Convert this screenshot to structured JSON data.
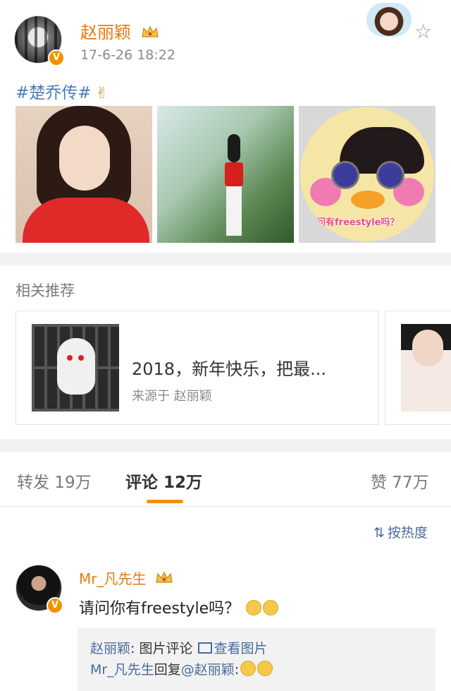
{
  "post": {
    "author": "赵丽颖",
    "timestamp": "17-6-26 18:22",
    "hashtag": "#楚乔传#",
    "photo_caption": "请问有freestyle吗？",
    "verified_icon": "v-badge-icon",
    "colors": {
      "author": "#e8790d",
      "hashtag": "#4a7cba"
    }
  },
  "related": {
    "title": "相关推荐",
    "card_title": "2018，新年快乐，把最...",
    "card_source": "来源于 赵丽颖"
  },
  "tabs": {
    "repost": "转发 19万",
    "comment": "评论 12万",
    "like": "赞 77万",
    "active": "comment",
    "accent": "#f29100"
  },
  "comments": {
    "sort_label": "按热度",
    "item": {
      "user": "Mr_凡先生",
      "text": "请问你有freestyle吗？",
      "reply_line1_user": "赵丽颖",
      "reply_line1_text": ": 图片评论",
      "reply_line1_link": "查看图片",
      "reply_line2_user": "Mr_凡先生",
      "reply_line2_text": "回复",
      "reply_line2_mention": "@赵丽颖",
      "reply_line2_suffix": ":"
    }
  }
}
